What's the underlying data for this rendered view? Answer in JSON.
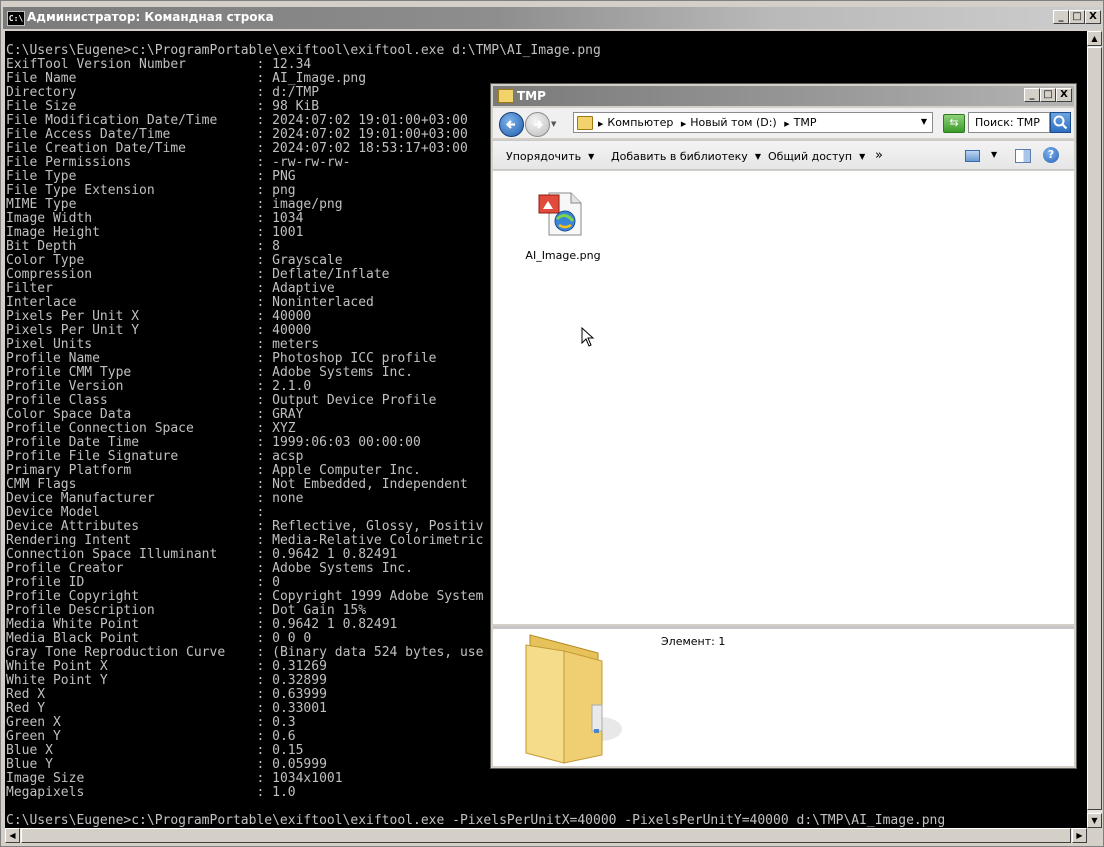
{
  "cmd_window": {
    "title": "Администратор: Командная строка",
    "icon_text": "C:\\",
    "command": "C:\\Users\\Eugene>c:\\ProgramPortable\\exiftool\\exiftool.exe d:\\TMP\\AI_Image.png",
    "exif_rows": [
      [
        "ExifTool Version Number",
        "12.34"
      ],
      [
        "File Name",
        "AI_Image.png"
      ],
      [
        "Directory",
        "d:/TMP"
      ],
      [
        "File Size",
        "98 KiB"
      ],
      [
        "File Modification Date/Time",
        "2024:07:02 19:01:00+03:00"
      ],
      [
        "File Access Date/Time",
        "2024:07:02 19:01:00+03:00"
      ],
      [
        "File Creation Date/Time",
        "2024:07:02 18:53:17+03:00"
      ],
      [
        "File Permissions",
        "-rw-rw-rw-"
      ],
      [
        "File Type",
        "PNG"
      ],
      [
        "File Type Extension",
        "png"
      ],
      [
        "MIME Type",
        "image/png"
      ],
      [
        "Image Width",
        "1034"
      ],
      [
        "Image Height",
        "1001"
      ],
      [
        "Bit Depth",
        "8"
      ],
      [
        "Color Type",
        "Grayscale"
      ],
      [
        "Compression",
        "Deflate/Inflate"
      ],
      [
        "Filter",
        "Adaptive"
      ],
      [
        "Interlace",
        "Noninterlaced"
      ],
      [
        "Pixels Per Unit X",
        "40000"
      ],
      [
        "Pixels Per Unit Y",
        "40000"
      ],
      [
        "Pixel Units",
        "meters"
      ],
      [
        "Profile Name",
        "Photoshop ICC profile"
      ],
      [
        "Profile CMM Type",
        "Adobe Systems Inc."
      ],
      [
        "Profile Version",
        "2.1.0"
      ],
      [
        "Profile Class",
        "Output Device Profile"
      ],
      [
        "Color Space Data",
        "GRAY"
      ],
      [
        "Profile Connection Space",
        "XYZ"
      ],
      [
        "Profile Date Time",
        "1999:06:03 00:00:00"
      ],
      [
        "Profile File Signature",
        "acsp"
      ],
      [
        "Primary Platform",
        "Apple Computer Inc."
      ],
      [
        "CMM Flags",
        "Not Embedded, Independent"
      ],
      [
        "Device Manufacturer",
        "none"
      ],
      [
        "Device Model",
        ""
      ],
      [
        "Device Attributes",
        "Reflective, Glossy, Positiv"
      ],
      [
        "Rendering Intent",
        "Media-Relative Colorimetric"
      ],
      [
        "Connection Space Illuminant",
        "0.9642 1 0.82491"
      ],
      [
        "Profile Creator",
        "Adobe Systems Inc."
      ],
      [
        "Profile ID",
        "0"
      ],
      [
        "Profile Copyright",
        "Copyright 1999 Adobe System"
      ],
      [
        "Profile Description",
        "Dot Gain 15%"
      ],
      [
        "Media White Point",
        "0.9642 1 0.82491"
      ],
      [
        "Media Black Point",
        "0 0 0"
      ],
      [
        "Gray Tone Reproduction Curve",
        "(Binary data 524 bytes, use"
      ],
      [
        "White Point X",
        "0.31269"
      ],
      [
        "White Point Y",
        "0.32899"
      ],
      [
        "Red X",
        "0.63999"
      ],
      [
        "Red Y",
        "0.33001"
      ],
      [
        "Green X",
        "0.3"
      ],
      [
        "Green Y",
        "0.6"
      ],
      [
        "Blue X",
        "0.15"
      ],
      [
        "Blue Y",
        "0.05999"
      ],
      [
        "Image Size",
        "1034x1001"
      ],
      [
        "Megapixels",
        "1.0"
      ]
    ],
    "command2": "C:\\Users\\Eugene>c:\\ProgramPortable\\exiftool\\exiftool.exe -PixelsPerUnitX=40000 -PixelsPerUnitY=40000 d:\\TMP\\AI_Image.png",
    "buttons": {
      "minimize": "_",
      "maximize": "□",
      "close": "X"
    }
  },
  "explorer": {
    "title": "TMP",
    "breadcrumb": [
      "Компьютер",
      "Новый том (D:)",
      "TMP"
    ],
    "search_placeholder": "Поиск: TMP",
    "commands": {
      "organize": "Упорядочить",
      "add_library": "Добавить в библиотеку",
      "share": "Общий доступ",
      "more": "»"
    },
    "file": {
      "name": "AI_Image.png"
    },
    "details": {
      "count_text": "Элемент: 1"
    },
    "buttons": {
      "minimize": "_",
      "maximize": "□",
      "close": "X"
    }
  },
  "colors": {
    "console_bg": "#000000",
    "console_fg": "#c0c0c0",
    "title_gray": "#8e8e8e"
  }
}
